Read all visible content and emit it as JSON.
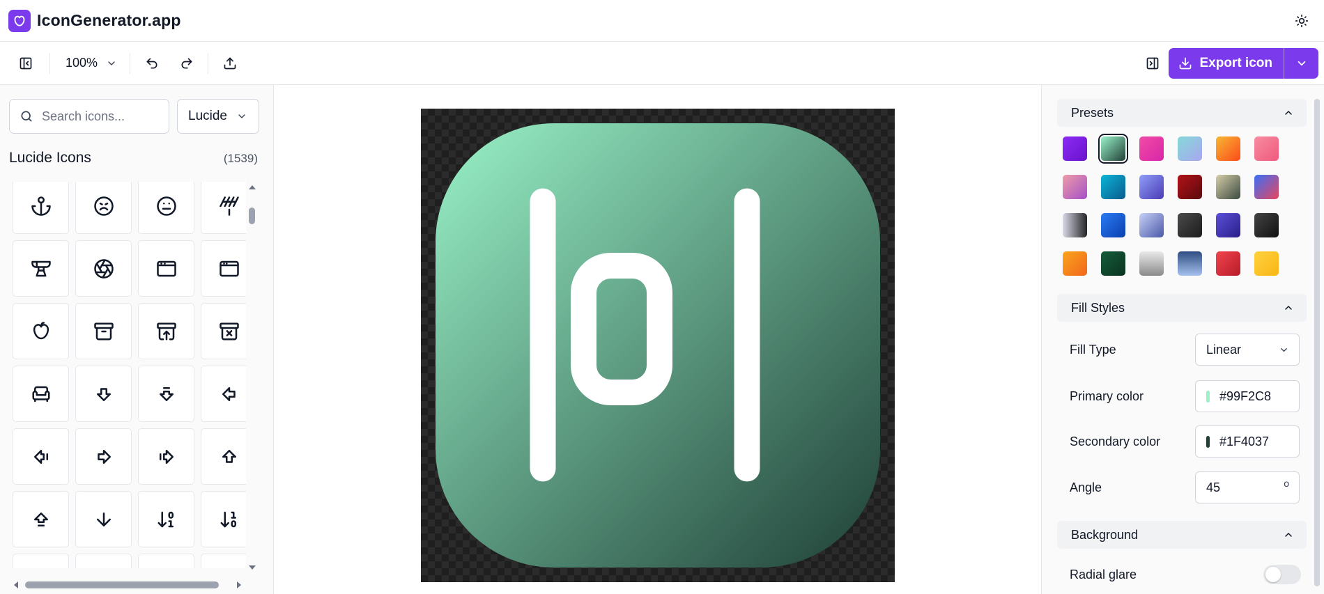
{
  "app": {
    "title": "IconGenerator.app"
  },
  "toolbar": {
    "zoom": "100%",
    "export_label": "Export icon"
  },
  "library": {
    "search_placeholder": "Search icons...",
    "selected_library": "Lucide",
    "heading": "Lucide Icons",
    "count": "(1539)",
    "icons": [
      "anchor-icon",
      "frown-icon",
      "meh-icon",
      "antenna-icon",
      "anvil-icon",
      "aperture-icon",
      "app-window-icon",
      "app-window-mac-icon",
      "apple-icon",
      "archive-icon",
      "archive-restore-icon",
      "archive-x-icon",
      "armchair-icon",
      "arrow-big-down-icon",
      "arrow-big-down-dash-icon",
      "arrow-big-left-icon",
      "arrow-big-left-dash-icon",
      "arrow-big-right-icon",
      "arrow-big-right-dash-icon",
      "arrow-big-up-icon",
      "arrow-big-up-dash-icon",
      "arrow-down-icon",
      "arrow-down-0-1-icon",
      "arrow-down-1-0-icon"
    ]
  },
  "canvas": {
    "icon": "square-pipes-icon",
    "gradient_start": "#99F2C8",
    "gradient_end": "#1F4037",
    "glyph_color": "#FFFFFF"
  },
  "presets": {
    "title": "Presets",
    "selected_index": 1,
    "swatches": [
      "linear-gradient(135deg,#8b2cf5,#6a11cb)",
      "linear-gradient(135deg,#99F2C8,#1F4037)",
      "linear-gradient(135deg,#f04ba5,#d926a8)",
      "linear-gradient(135deg,#84d9d8,#a9a6ef)",
      "linear-gradient(135deg,#f7b733,#fc4a1a)",
      "linear-gradient(135deg,#f78ca0,#f05a7e)",
      "linear-gradient(135deg,#ee9ca7,#a450c8)",
      "linear-gradient(135deg,#0ab5d9,#0a5a8c)",
      "linear-gradient(135deg,#8e9ef8,#4b3bb5)",
      "linear-gradient(135deg,#b31217,#5a0a0e)",
      "linear-gradient(135deg,#d6cea8,#3b4a3f)",
      "linear-gradient(135deg,#3a6ff7,#e8455f)",
      "linear-gradient(90deg,#d9dae8,#232526)",
      "linear-gradient(135deg,#2a7bf2,#0b3fb0)",
      "linear-gradient(135deg,#c7d1f7,#4a58a8)",
      "linear-gradient(135deg,#4a4a4a,#1c1c1c)",
      "linear-gradient(135deg,#5b4fd6,#2a1f8a)",
      "linear-gradient(135deg,#434343,#111111)",
      "linear-gradient(135deg,#f9a51d,#f2661c)",
      "linear-gradient(135deg,#165c3a,#0a3320)",
      "linear-gradient(180deg,#e9e9e9,#8a8a8a)",
      "linear-gradient(180deg,#2f4d82,#a6c1ee)",
      "linear-gradient(135deg,#f0454d,#b81b2a)",
      "linear-gradient(135deg,#ffd23f,#f9b515)"
    ]
  },
  "fill": {
    "title": "Fill Styles",
    "type_label": "Fill Type",
    "type_value": "Linear",
    "primary_label": "Primary color",
    "primary_value": "#99F2C8",
    "secondary_label": "Secondary color",
    "secondary_value": "#1F4037",
    "angle_label": "Angle",
    "angle_value": "45",
    "angle_unit": "o"
  },
  "background": {
    "title": "Background",
    "radial_glare_label": "Radial glare",
    "radial_glare_on": false
  }
}
